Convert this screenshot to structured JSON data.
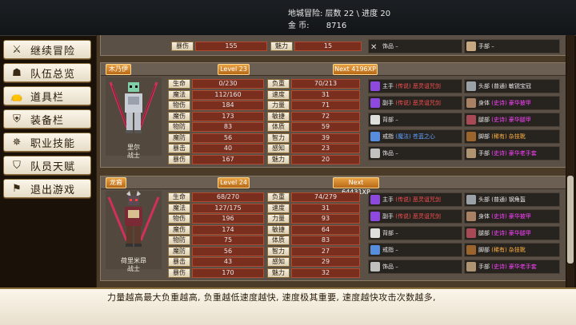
{
  "topbar": {
    "line1": "地城冒险:  层数 22 \\ 进度 20",
    "line2_label": "金      币:",
    "gold": "8716"
  },
  "sidebar": {
    "items": [
      {
        "label": "继续冒险",
        "icon": "swords-icon"
      },
      {
        "label": "队伍总览",
        "icon": "party-icon"
      },
      {
        "label": "道具栏",
        "icon": "bag-icon"
      },
      {
        "label": "装备栏",
        "icon": "armor-icon"
      },
      {
        "label": "职业技能",
        "icon": "skill-icon"
      },
      {
        "label": "队员天赋",
        "icon": "talent-icon"
      },
      {
        "label": "退出游戏",
        "icon": "exit-icon"
      }
    ]
  },
  "partial": {
    "s1_label": "暴伤",
    "s1_val": "155",
    "s2_label": "魅力",
    "s2_val": "15",
    "accessory": "饰品 –",
    "hands": "手部 –"
  },
  "members": [
    {
      "name": "木乃伊",
      "level": "Level 23",
      "next": "Next 4196XP",
      "display_name": "里尔",
      "job": "战士",
      "stats": [
        [
          "生命",
          "0/230",
          "负重",
          "70/213"
        ],
        [
          "魔法",
          "112/160",
          "速度",
          "31"
        ],
        [
          "物伤",
          "184",
          "力量",
          "71"
        ],
        [
          "魔伤",
          "173",
          "敏捷",
          "72"
        ],
        [
          "物防",
          "83",
          "体质",
          "59"
        ],
        [
          "魔防",
          "56",
          "智力",
          "39"
        ],
        [
          "暴击",
          "40",
          "感知",
          "23"
        ],
        [
          "暴伤",
          "167",
          "魅力",
          "20"
        ]
      ],
      "equip": [
        [
          "主手",
          "(传说) 恶灵诅咒剑",
          "q-leg",
          "头部",
          "(普通) 敏锐宝冠",
          "q-plain"
        ],
        [
          "副手",
          "(传说) 恶灵诅咒剑",
          "q-leg",
          "身体",
          "(史诗) 豪华披甲",
          "q-epic"
        ],
        [
          "背部",
          "–",
          "",
          "腿部",
          "(史诗) 豪华腿甲",
          "q-epic"
        ],
        [
          "戒指",
          "(魔法) 苍蓝之心",
          "q-blu",
          "脚部",
          "(稀有) 杂技靴",
          "q-org"
        ],
        [
          "饰品",
          "–",
          "",
          "手部",
          "(史诗) 豪华老手套",
          "q-epic"
        ]
      ]
    },
    {
      "name": "龙裔",
      "level": "Level 24",
      "next": "Next 64431XP",
      "display_name": "荷里米昂",
      "job": "战士",
      "stats": [
        [
          "生命",
          "68/270",
          "负重",
          "74/279"
        ],
        [
          "魔法",
          "127/175",
          "速度",
          "31"
        ],
        [
          "物伤",
          "196",
          "力量",
          "93"
        ],
        [
          "魔伤",
          "174",
          "敏捷",
          "64"
        ],
        [
          "物防",
          "75",
          "体质",
          "83"
        ],
        [
          "魔防",
          "56",
          "智力",
          "27"
        ],
        [
          "暴击",
          "43",
          "感知",
          "29"
        ],
        [
          "暴伤",
          "170",
          "魅力",
          "32"
        ]
      ],
      "equip": [
        [
          "主手",
          "(传说) 恶灵诅咒剑",
          "q-leg",
          "头部",
          "(普通) 钢角盔",
          "q-plain"
        ],
        [
          "副手",
          "(传说) 恶灵诅咒剑",
          "q-leg",
          "身体",
          "(史诗) 豪华披甲",
          "q-epic"
        ],
        [
          "背部",
          "–",
          "",
          "腿部",
          "(史诗) 豪华腿甲",
          "q-epic"
        ],
        [
          "戒指",
          "–",
          "",
          "脚部",
          "(稀有) 杂技靴",
          "q-org"
        ],
        [
          "饰品",
          "–",
          "",
          "手部",
          "(史诗) 豪华老手套",
          "q-epic"
        ]
      ]
    }
  ],
  "tip": "力量越高最大负重越高, 负重越低速度越快, 速度极其重要, 速度越快攻击次数越多,"
}
